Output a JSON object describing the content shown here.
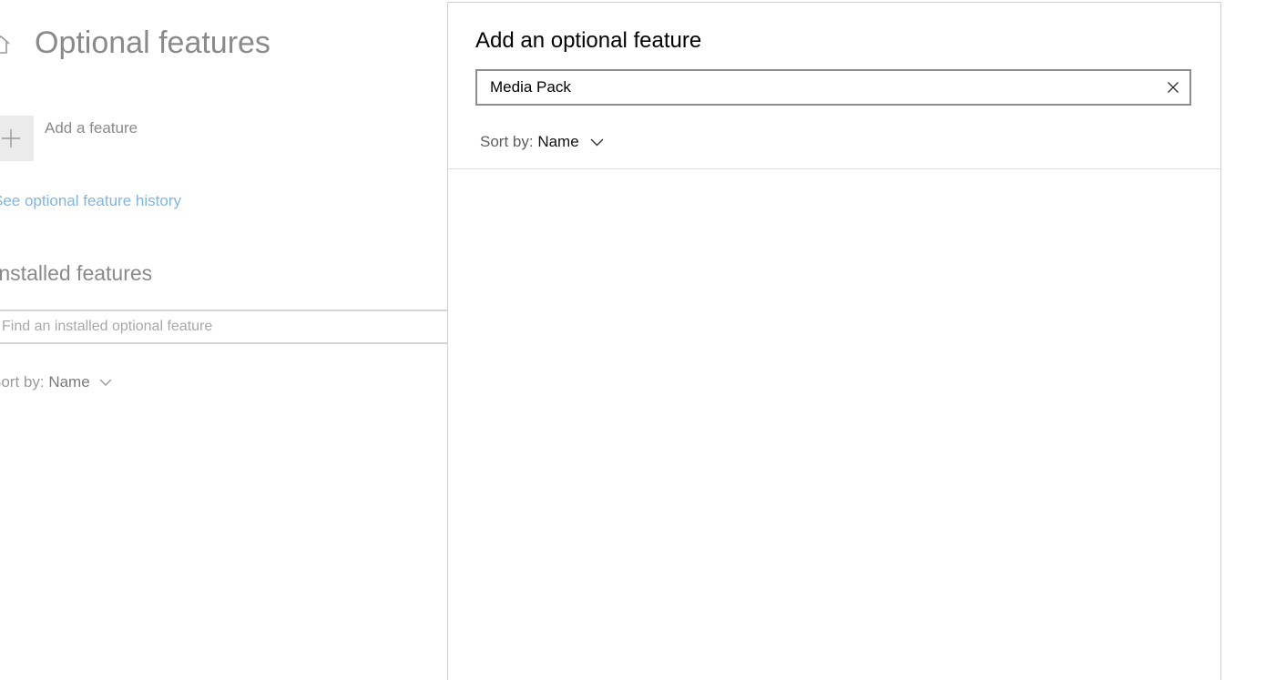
{
  "background": {
    "page_title": "Optional features",
    "add_feature_label": "Add a feature",
    "history_link": "See optional feature history",
    "installed_heading": "Installed features",
    "installed_search_placeholder": "Find an installed optional feature",
    "sort_label": "Sort by:",
    "sort_value": "Name",
    "icons": [
      "home-icon",
      "plus-icon",
      "chevron-down-icon"
    ]
  },
  "dialog": {
    "title": "Add an optional feature",
    "search_value": "Media Pack",
    "sort_label": "Sort by:",
    "sort_value": "Name",
    "results": [],
    "icons": [
      "close-icon",
      "chevron-down-icon"
    ]
  },
  "colors": {
    "link": "#7fb5e0",
    "search_border": "#8c8c8c",
    "tile_bg": "#ebebeb"
  }
}
